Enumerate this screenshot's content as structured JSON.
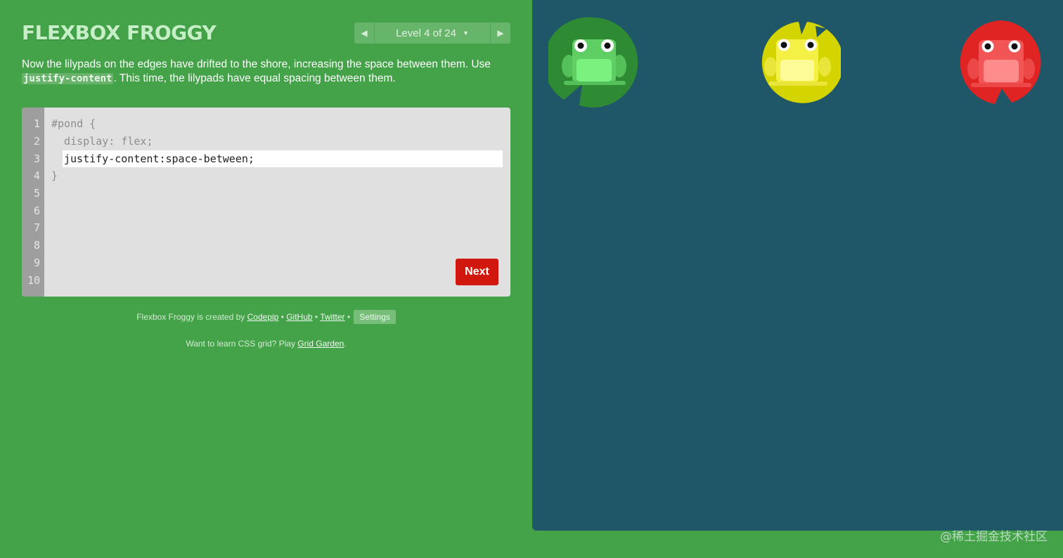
{
  "app": {
    "title": "FLEXBOX FROGGY"
  },
  "level_nav": {
    "prev_icon": "triangle-left-icon",
    "label": "Level 4 of 24",
    "caret_icon": "caret-down-icon",
    "next_icon": "triangle-right-icon"
  },
  "instructions": {
    "part1": "Now the lilypads on the edges have drifted to the shore, increasing the space between them. Use ",
    "code": "justify-content",
    "part2": ". This time, the lilypads have equal spacing between them."
  },
  "editor": {
    "line_numbers": [
      "1",
      "2",
      "3",
      "4",
      "5",
      "6",
      "7",
      "8",
      "9",
      "10"
    ],
    "line1": "#pond {",
    "line2": "  display: flex;",
    "input_value": "justify-content:space-between;",
    "line4": "}",
    "next_label": "Next"
  },
  "footer": {
    "credits_prefix": "Flexbox Froggy is created by ",
    "codepip": "Codepip",
    "sep1": " • ",
    "github": "GitHub",
    "sep2": " • ",
    "twitter": "Twitter",
    "sep3": " • ",
    "settings": "Settings",
    "learn_prefix": "Want to learn CSS grid? Play ",
    "grid_garden": "Grid Garden",
    "learn_suffix": "."
  },
  "pond": {
    "frogs": [
      {
        "color": "green",
        "lily": "#2e8b33",
        "body": "#5fcf64",
        "belly": "#7bf27f"
      },
      {
        "color": "yellow",
        "lily": "#d4d400",
        "body": "#f4f046",
        "belly": "#fdfb97"
      },
      {
        "color": "red",
        "lily": "#e02424",
        "body": "#f25555",
        "belly": "#ff8c8c"
      }
    ]
  },
  "watermark": "@稀土掘金技术社区"
}
